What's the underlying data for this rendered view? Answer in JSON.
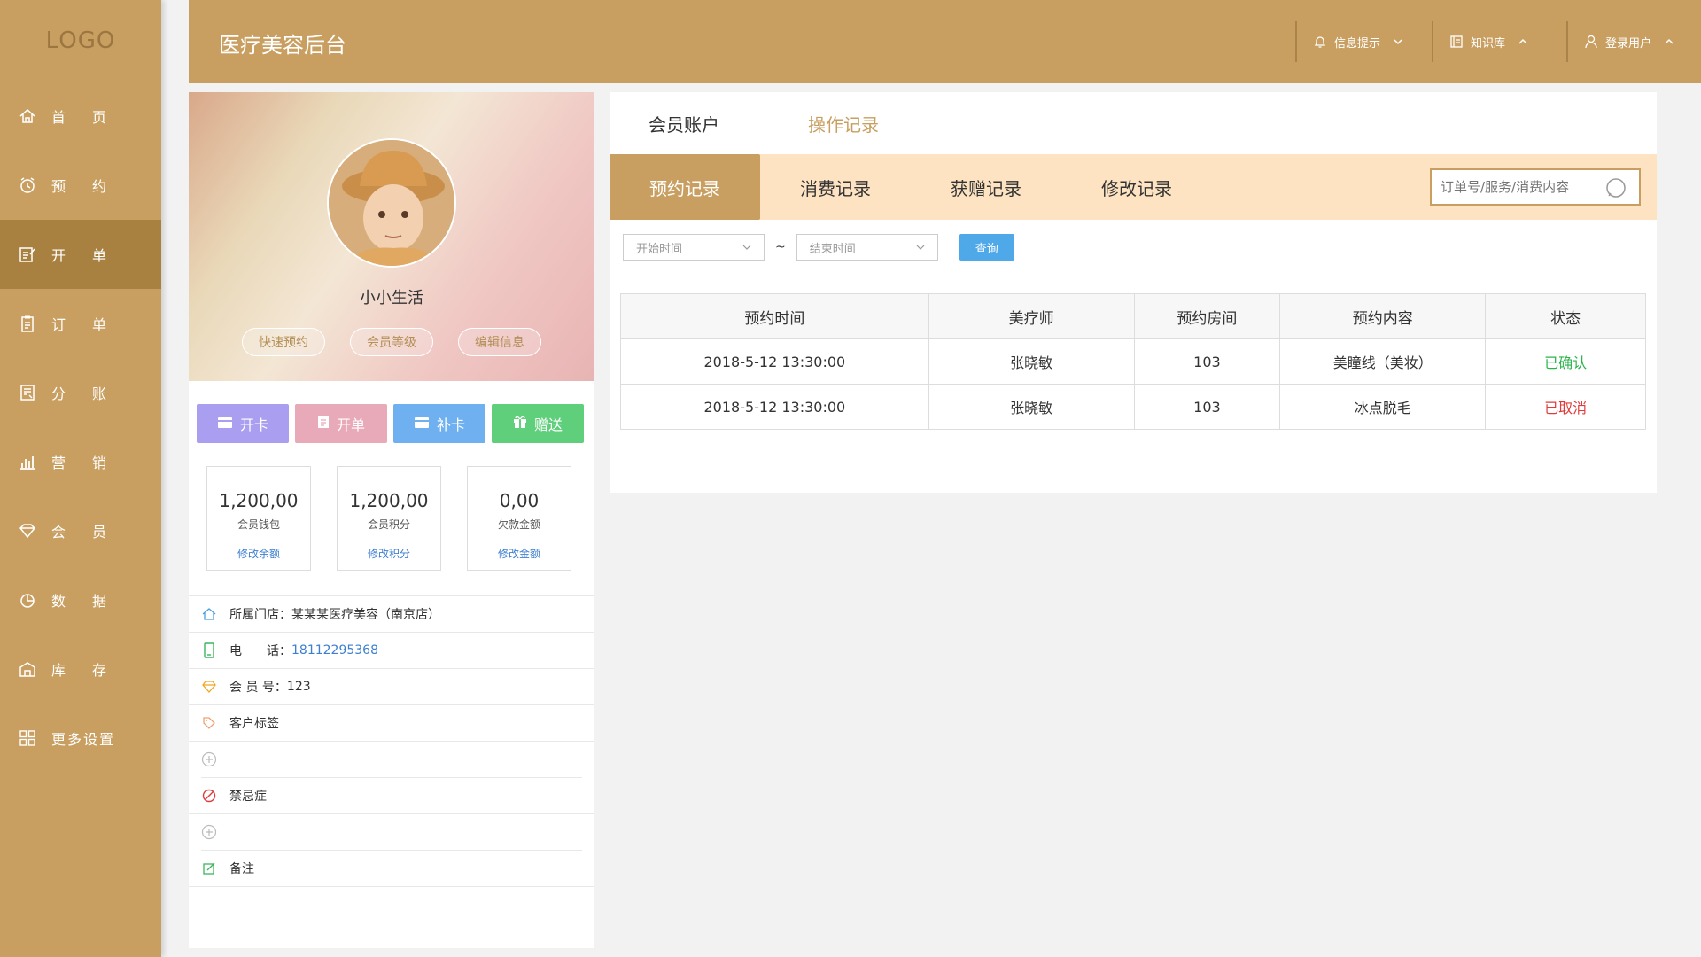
{
  "sidebar": {
    "logo": "LOGO",
    "items": [
      {
        "label": "首页",
        "icon": "home-icon"
      },
      {
        "label": "预约",
        "icon": "alarm-clock-icon"
      },
      {
        "label": "开单",
        "icon": "edit-document-icon"
      },
      {
        "label": "订单",
        "icon": "clipboard-icon"
      },
      {
        "label": "分账",
        "icon": "ledger-icon"
      },
      {
        "label": "营销",
        "icon": "bar-chart-icon"
      },
      {
        "label": "会员",
        "icon": "diamond-icon"
      },
      {
        "label": "数据",
        "icon": "pie-chart-icon"
      },
      {
        "label": "库存",
        "icon": "warehouse-icon"
      },
      {
        "label": "更多设置",
        "icon": "grid-icon"
      }
    ],
    "active_index": 2
  },
  "header": {
    "title": "医疗美容后台",
    "notifications": "信息提示",
    "knowledge": "知识库",
    "user": "登录用户"
  },
  "profile": {
    "name": "小小生活",
    "tags": [
      "快速预约",
      "会员等级",
      "编辑信息"
    ],
    "actions": [
      {
        "label": "开卡",
        "color": "#a99ef0"
      },
      {
        "label": "开单",
        "color": "#e8a9b8"
      },
      {
        "label": "补卡",
        "color": "#6fb1f0"
      },
      {
        "label": "赠送",
        "color": "#5fcf7c"
      }
    ],
    "stats": [
      {
        "value": "1,200,00",
        "label": "会员钱包",
        "edit": "修改余额"
      },
      {
        "value": "1,200,00",
        "label": "会员积分",
        "edit": "修改积分"
      },
      {
        "value": "0,00",
        "label": "欠款金额",
        "edit": "修改金额"
      }
    ],
    "store_label": "所属门店：",
    "store": "某某某医疗美容（南京店）",
    "phone_label": "电　　话：",
    "phone": "18112295368",
    "member_no_label": "会 员 号：",
    "member_no": "123",
    "customer_tags": "客户标签",
    "contraindications": "禁忌症",
    "notes": "备注"
  },
  "main": {
    "top_tabs": [
      "会员账户",
      "操作记录"
    ],
    "record_tabs": [
      "预约记录",
      "消费记录",
      "获赠记录",
      "修改记录"
    ],
    "search_placeholder": "订单号/服务/消费内容",
    "start_placeholder": "开始时间",
    "end_placeholder": "结束时间",
    "tilde": "~",
    "query": "查询",
    "table": {
      "headers": [
        "预约时间",
        "美疗师",
        "预约房间",
        "预约内容",
        "状态"
      ],
      "rows": [
        [
          "2018-5-12  13:30:00",
          "张晓敏",
          "103",
          "美瞳线（美妆）",
          "已确认"
        ],
        [
          "2018-5-12  13:30:00",
          "张晓敏",
          "103",
          "冰点脱毛",
          "已取消"
        ]
      ]
    }
  },
  "colors": {
    "brand": "#c89f60",
    "brand_dark": "#a8803f",
    "tab_bg": "#fde3c1",
    "confirmed": "#2bb34a",
    "cancelled": "#e03b3b"
  }
}
